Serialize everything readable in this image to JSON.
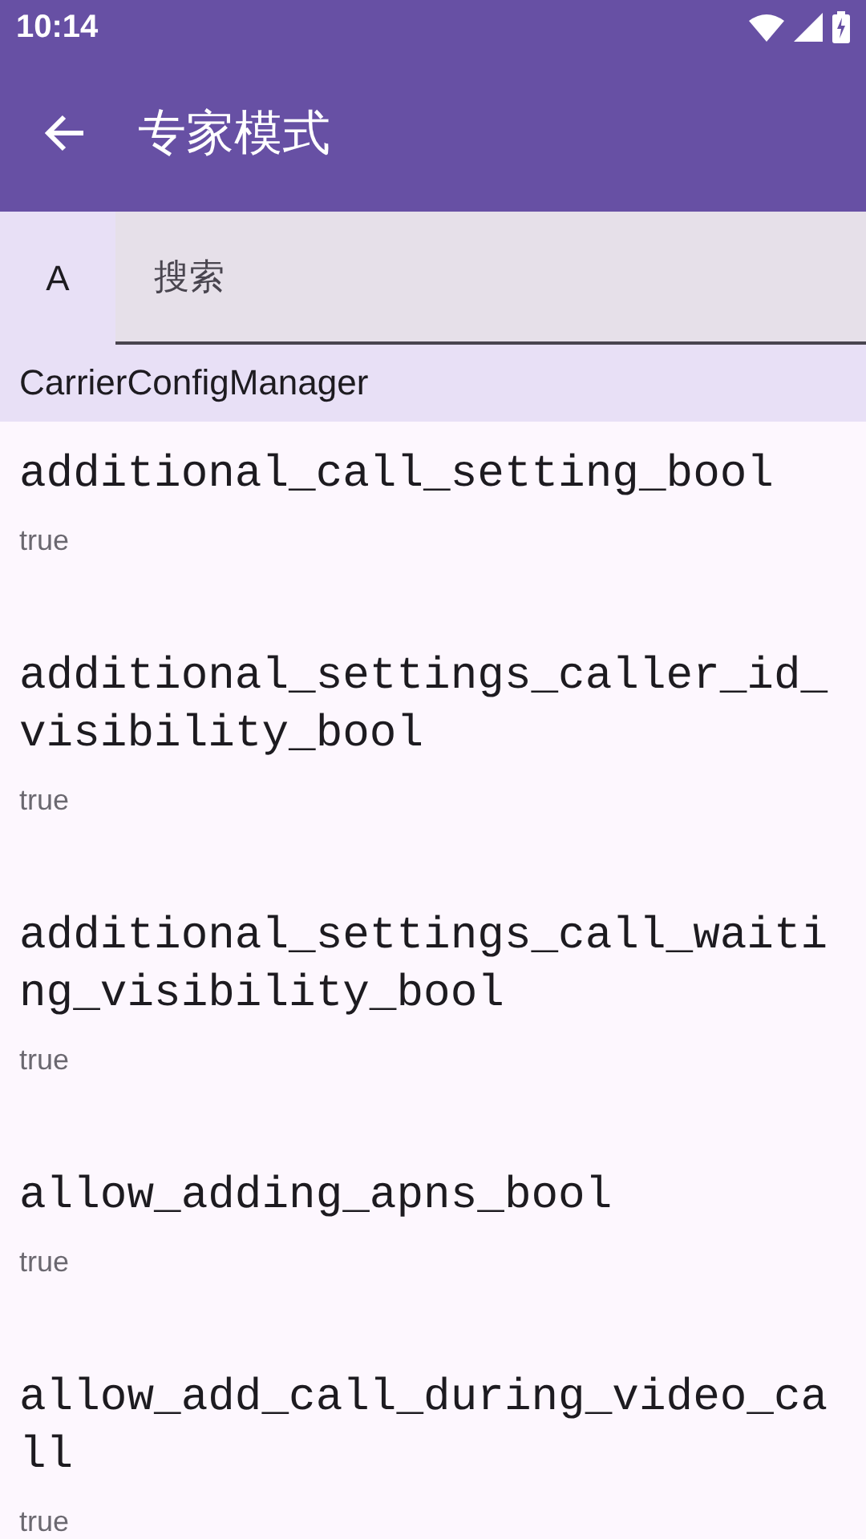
{
  "status_bar": {
    "time": "10:14"
  },
  "app_bar": {
    "title": "专家模式"
  },
  "filter": {
    "letter": "A",
    "search": {
      "placeholder": "搜索"
    }
  },
  "section": {
    "title": "CarrierConfigManager"
  },
  "items": [
    {
      "name": "additional_call_setting_bool",
      "value": "true"
    },
    {
      "name": "additional_settings_caller_id_visibility_bool",
      "value": "true"
    },
    {
      "name": "additional_settings_call_waiting_visibility_bool",
      "value": "true"
    },
    {
      "name": "allow_adding_apns_bool",
      "value": "true"
    },
    {
      "name": "allow_add_call_during_video_call",
      "value": "true"
    }
  ]
}
